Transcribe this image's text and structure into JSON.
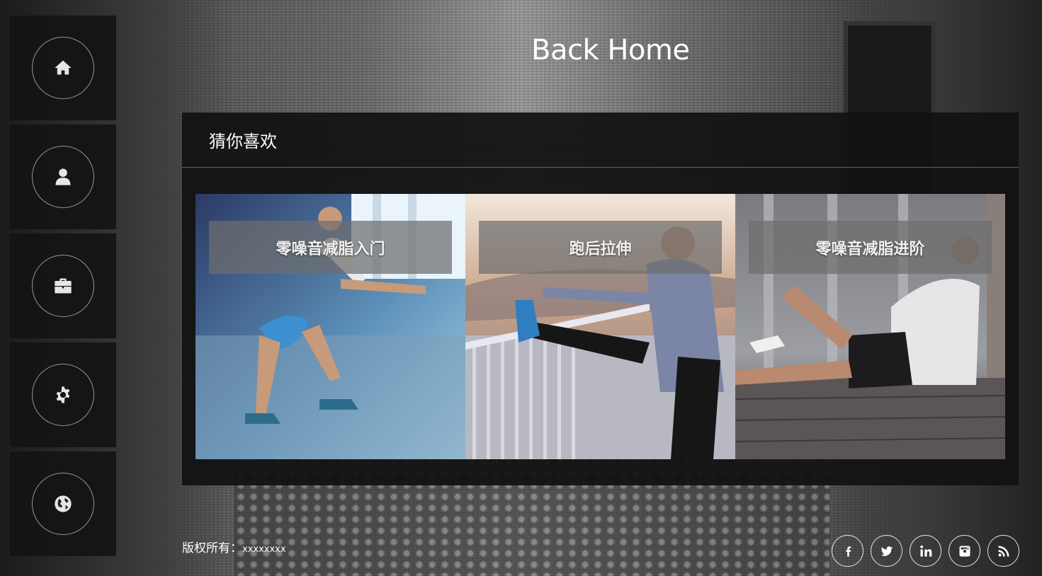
{
  "page": {
    "title": "Back Home"
  },
  "sidebar": {
    "items": [
      {
        "icon": "home-icon"
      },
      {
        "icon": "user-icon"
      },
      {
        "icon": "briefcase-icon"
      },
      {
        "icon": "gear-icon"
      },
      {
        "icon": "globe-icon"
      }
    ]
  },
  "panel": {
    "heading": "猜你喜欢",
    "accent_color": "#b83a3a",
    "cards": [
      {
        "label": "零噪音减脂入门",
        "scene": "squat-workout-photo"
      },
      {
        "label": "跑后拉伸",
        "scene": "post-run-stretch-photo"
      },
      {
        "label": "零噪音减脂进阶",
        "scene": "crunch-workout-photo"
      }
    ]
  },
  "footer": {
    "copyright_label": "版权所有：",
    "copyright_owner": "xxxxxxxx",
    "socials": [
      {
        "icon": "facebook-icon"
      },
      {
        "icon": "twitter-icon"
      },
      {
        "icon": "linkedin-icon"
      },
      {
        "icon": "instagram-icon"
      },
      {
        "icon": "rss-icon"
      }
    ]
  }
}
